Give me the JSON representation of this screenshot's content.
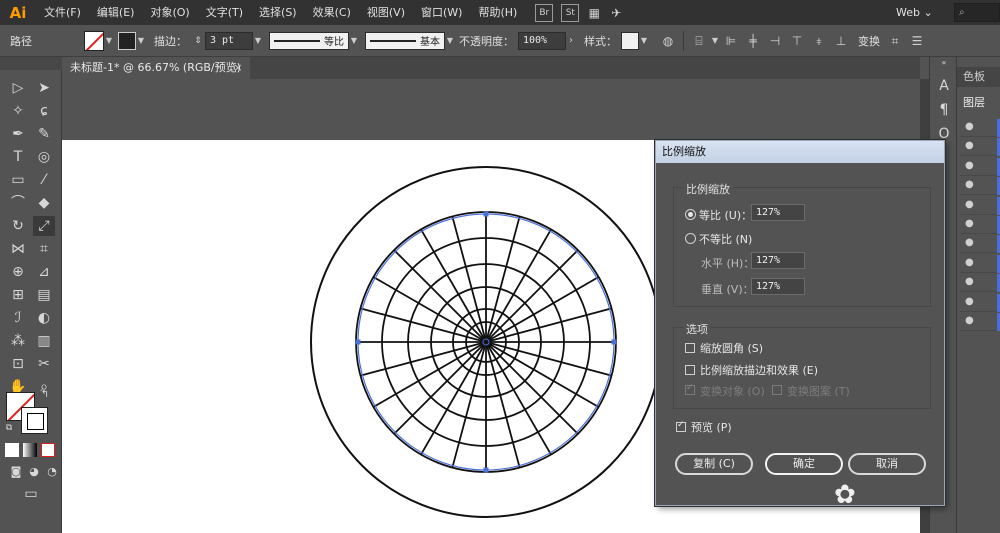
{
  "app": {
    "logo": "Ai"
  },
  "menubar": {
    "items": [
      "文件(F)",
      "编辑(E)",
      "对象(O)",
      "文字(T)",
      "选择(S)",
      "效果(C)",
      "视图(V)",
      "窗口(W)",
      "帮助(H)"
    ],
    "badges": [
      "Br",
      "St"
    ],
    "workspace": "Web ⌄",
    "search_placeholder": "⌕"
  },
  "controlbar": {
    "object_type": "路径",
    "stroke_label": "描边：",
    "stroke_weight": "3 pt",
    "profile_label": "等比",
    "brush_label": "基本",
    "opacity_label": "不透明度：",
    "opacity_value": "100%",
    "style_label": "样式：",
    "transform_label": "变换"
  },
  "document": {
    "tab_title": "未标题-1* @ 66.67% (RGB/预览)",
    "close_glyph": "×"
  },
  "right_strip": {
    "icons": [
      "character-icon",
      "paragraph-icon",
      "opentype-icon"
    ]
  },
  "layers_panel": {
    "tabs": [
      "色板",
      "图层"
    ],
    "row_count": 11
  },
  "dialog": {
    "title": "比例缩放",
    "scale_group_title": "比例缩放",
    "uniform_label": "等比 (U)：",
    "uniform_value": "127%",
    "non_uniform_label": "不等比 (N)",
    "horizontal_label": "水平 (H)：",
    "horizontal_value": "127%",
    "vertical_label": "垂直 (V)：",
    "vertical_value": "127%",
    "options_group_title": "选项",
    "scale_corners_label": "缩放圆角 (S)",
    "scale_strokes_label": "比例缩放描边和效果 (E)",
    "transform_objects_label": "变换对象 (O)",
    "transform_patterns_label": "变换图案 (T)",
    "preview_label": "预览 (P)",
    "copy_button": "复制 (C)",
    "ok_button": "确定",
    "cancel_button": "取消",
    "uniform_checked": true,
    "preview_checked": true
  },
  "colors": {
    "selection_blue": "#4a70d8",
    "app_orange": "#ff9a00",
    "none_red": "#e01e1e"
  }
}
